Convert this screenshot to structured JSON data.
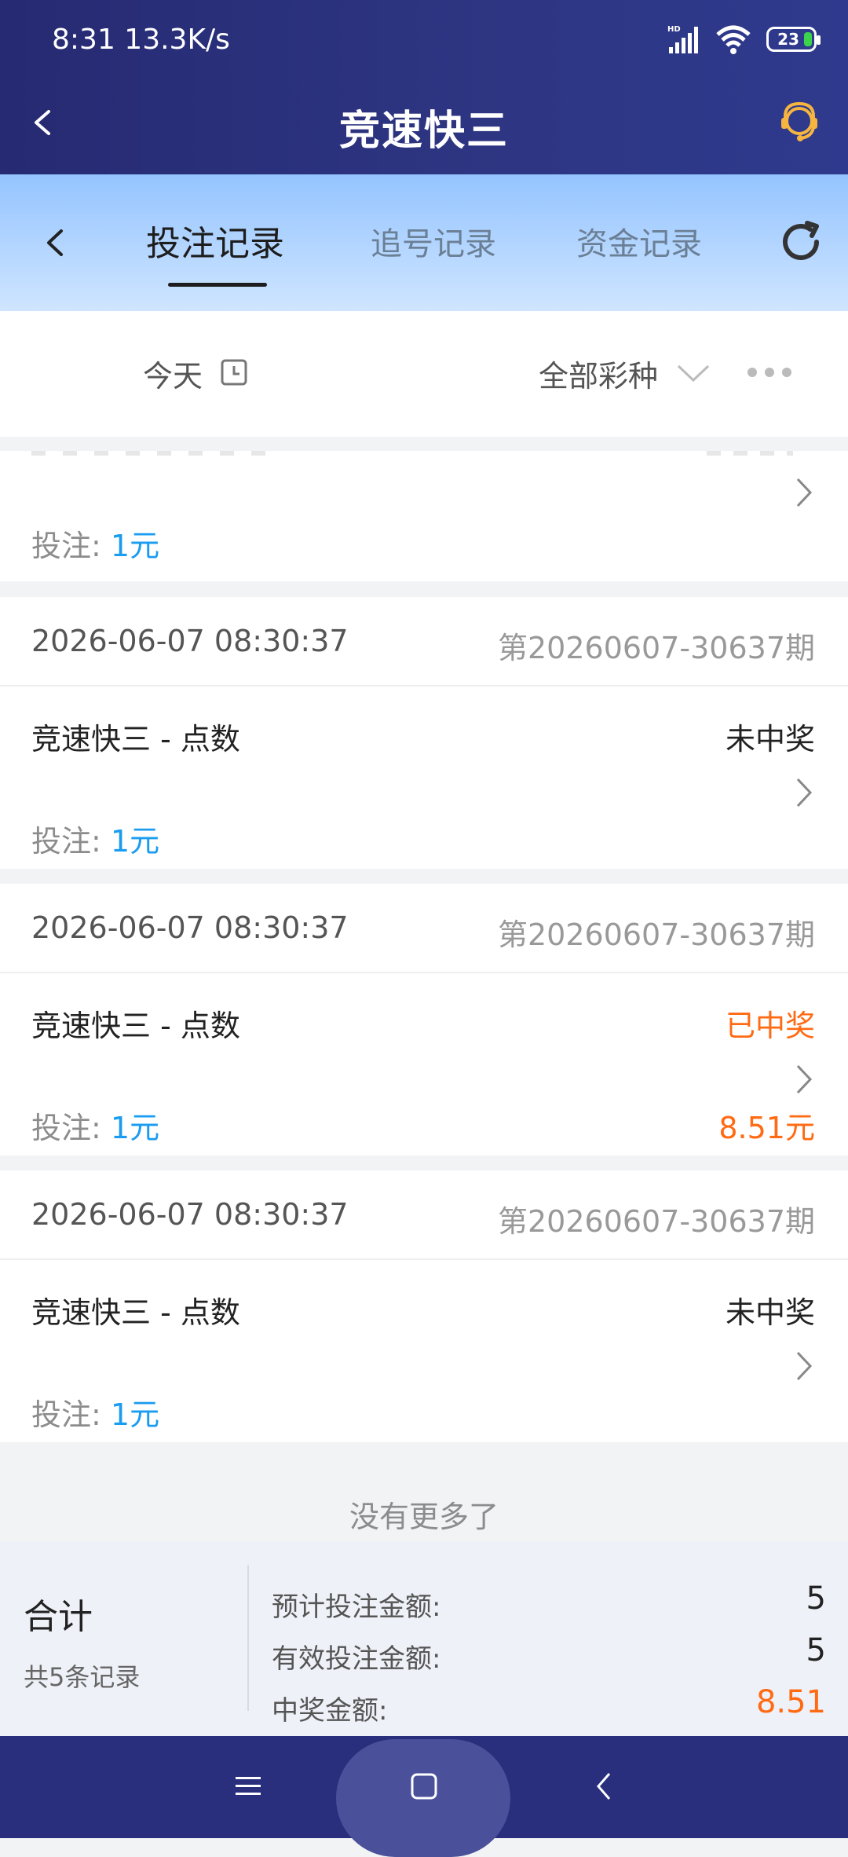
{
  "status_bar": {
    "time_speed": "8:31 13.3K/s",
    "battery": "23",
    "hd": "HD"
  },
  "header": {
    "title": "竞速快三"
  },
  "tabs": [
    {
      "label": "投注记录",
      "active": true
    },
    {
      "label": "追号记录",
      "active": false
    },
    {
      "label": "资金记录",
      "active": false
    }
  ],
  "filter": {
    "date_label": "今天",
    "lottery_label": "全部彩种"
  },
  "partial_record": {
    "bet_label": "投注:",
    "bet_amount": "1元"
  },
  "records": [
    {
      "date": "2026-06-07 08:30:37",
      "issue": "第20260607-30637期",
      "game": "竞速快三 - 点数",
      "status": "未中奖",
      "status_type": "lose",
      "bet_label": "投注:",
      "bet_amount": "1元",
      "prize": ""
    },
    {
      "date": "2026-06-07 08:30:37",
      "issue": "第20260607-30637期",
      "game": "竞速快三 - 点数",
      "status": "已中奖",
      "status_type": "win",
      "bet_label": "投注:",
      "bet_amount": "1元",
      "prize": "8.51元"
    },
    {
      "date": "2026-06-07 08:30:37",
      "issue": "第20260607-30637期",
      "game": "竞速快三 - 点数",
      "status": "未中奖",
      "status_type": "lose",
      "bet_label": "投注:",
      "bet_amount": "1元",
      "prize": ""
    }
  ],
  "no_more": "没有更多了",
  "summary": {
    "label": "合计",
    "count": "共5条记录",
    "rows": [
      {
        "label": "预计投注金额:",
        "value": "5"
      },
      {
        "label": "有效投注金额:",
        "value": "5"
      },
      {
        "label": "中奖金额:",
        "value": "8.51"
      }
    ]
  },
  "colors": {
    "accent_win": "#ff6a13",
    "bet_blue": "#1a9cf0",
    "header_bg": "#2e3683"
  }
}
